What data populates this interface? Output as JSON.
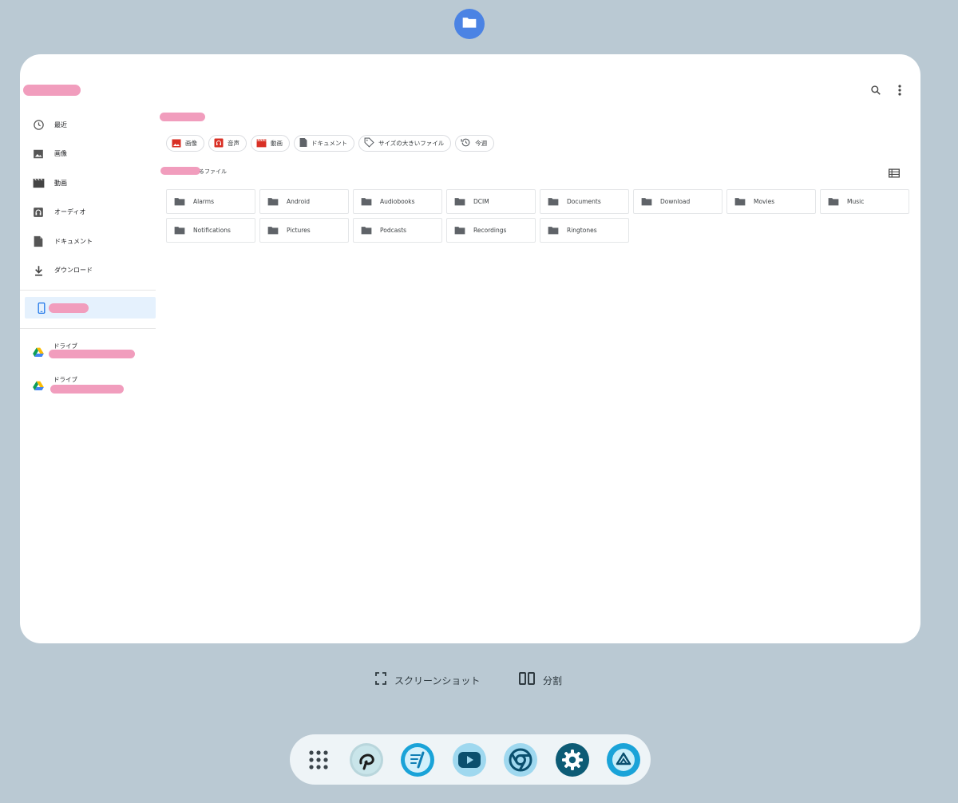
{
  "app_badge_icon": "folder-icon",
  "header": {
    "search_icon": "search-icon",
    "more_icon": "more-vert-icon"
  },
  "sidebar": {
    "items": [
      {
        "label": "最近",
        "icon": "clock-icon"
      },
      {
        "label": "画像",
        "icon": "image-icon"
      },
      {
        "label": "動画",
        "icon": "movie-icon"
      },
      {
        "label": "オーディオ",
        "icon": "audio-icon"
      },
      {
        "label": "ドキュメント",
        "icon": "document-icon"
      },
      {
        "label": "ダウンロード",
        "icon": "download-icon"
      }
    ],
    "device_icon": "phone-icon",
    "drives": [
      {
        "label": "ドライブ",
        "icon": "google-drive-icon"
      },
      {
        "label": "ドライブ",
        "icon": "google-drive-icon"
      }
    ]
  },
  "chips": [
    {
      "label": "画像",
      "icon": "image-icon",
      "color": "#d93025"
    },
    {
      "label": "音声",
      "icon": "audio-icon",
      "color": "#d93025"
    },
    {
      "label": "動画",
      "icon": "movie-icon",
      "color": "#d93025"
    },
    {
      "label": "ドキュメント",
      "icon": "document-icon",
      "color": "#5f6368"
    },
    {
      "label": "サイズの大きいファイル",
      "icon": "tag-icon",
      "color": "#5f6368"
    },
    {
      "label": "今週",
      "icon": "history-icon",
      "color": "#5f6368"
    }
  ],
  "section_label": "るファイル",
  "view_toggle_icon": "list-view-icon",
  "folders": [
    "Alarms",
    "Android",
    "Audiobooks",
    "DCIM",
    "Documents",
    "Download",
    "Movies",
    "Music",
    "Notifications",
    "Pictures",
    "Podcasts",
    "Recordings",
    "Ringtones"
  ],
  "actions": {
    "screenshot": {
      "label": "スクリーンショット",
      "icon": "screenshot-icon"
    },
    "split": {
      "label": "分割",
      "icon": "split-screen-icon"
    }
  },
  "dock": [
    {
      "icon": "app-grid-icon"
    },
    {
      "icon": "clip-studio-icon"
    },
    {
      "icon": "notes-app-icon"
    },
    {
      "icon": "youtube-icon"
    },
    {
      "icon": "chrome-icon"
    },
    {
      "icon": "settings-icon"
    },
    {
      "icon": "drive-app-icon"
    }
  ],
  "colors": {
    "background": "#bac9d3",
    "accent": "#4b83e4",
    "redaction": "#f19dbd",
    "selected_row": "#e5f1fd"
  }
}
